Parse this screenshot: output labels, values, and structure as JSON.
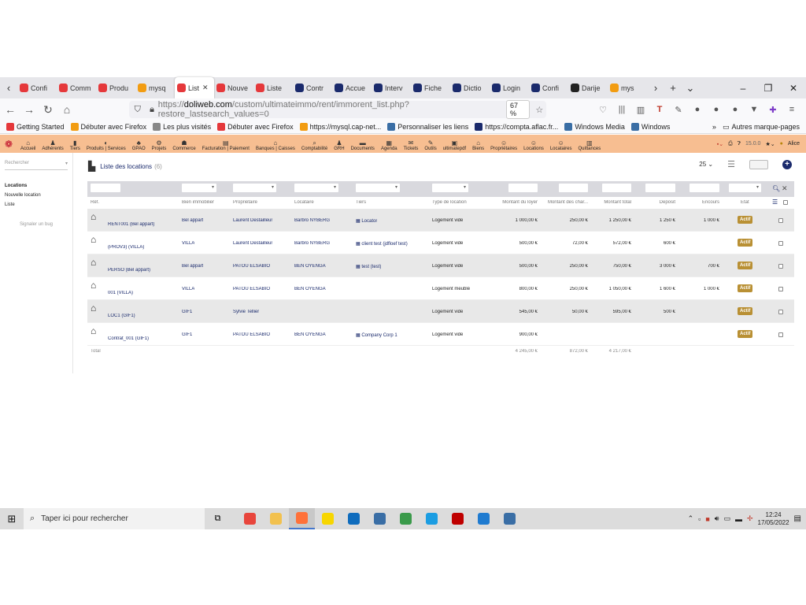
{
  "browser": {
    "tabs": [
      {
        "label": "Confi",
        "color": "#e5383b"
      },
      {
        "label": "Comm",
        "color": "#e5383b"
      },
      {
        "label": "Produ",
        "color": "#e5383b"
      },
      {
        "label": "mysq",
        "color": "#f29c11"
      },
      {
        "label": "List",
        "color": "#e5383b",
        "active": true
      },
      {
        "label": "Nouve",
        "color": "#e5383b"
      },
      {
        "label": "Liste",
        "color": "#e5383b"
      },
      {
        "label": "Contr",
        "color": "#1a2a6c"
      },
      {
        "label": "Accue",
        "color": "#1a2a6c"
      },
      {
        "label": "Interv",
        "color": "#1a2a6c"
      },
      {
        "label": "Fiche",
        "color": "#1a2a6c"
      },
      {
        "label": "Dictio",
        "color": "#1a2a6c"
      },
      {
        "label": "Login",
        "color": "#1a2a6c"
      },
      {
        "label": "Confi",
        "color": "#1a2a6c"
      },
      {
        "label": "Darije",
        "color": "#222222"
      },
      {
        "label": "mys",
        "color": "#f29c11"
      }
    ],
    "url_scheme": "https://",
    "url_domain": "doliweb.com",
    "url_path": "/custom/ultimateimmo/rent/immorent_list.php?restore_lastsearch_values=0",
    "zoom": "67 %",
    "bookmarks": [
      {
        "label": "Getting Started",
        "color": "#e5383b"
      },
      {
        "label": "Débuter avec Firefox",
        "color": "#f29c11"
      },
      {
        "label": "Les plus visités",
        "color": "#888888"
      },
      {
        "label": "Débuter avec Firefox",
        "color": "#e5383b"
      },
      {
        "label": "https://mysql.cap-net...",
        "color": "#f29c11"
      },
      {
        "label": "Personnaliser les liens",
        "color": "#3a6ea5"
      },
      {
        "label": "https://compta.aflac.fr...",
        "color": "#1a2a6c"
      },
      {
        "label": "Windows Media",
        "color": "#3a6ea5"
      },
      {
        "label": "Windows",
        "color": "#3a6ea5"
      }
    ],
    "other_bookmarks": "Autres marque-pages"
  },
  "topmenu": {
    "items": [
      "Accueil",
      "Adhérents",
      "Tiers",
      "Produits | Services",
      "GPAO",
      "Projets",
      "Commerce",
      "Facturation | Paiement",
      "Banques | Caisses",
      "Comptabilité",
      "GRH",
      "Documents",
      "Agenda",
      "Tickets",
      "Outils",
      "ultimatepdf",
      "Biens",
      "Propriétaires",
      "Locations",
      "Locataires",
      "Quittances"
    ],
    "version": "15.0.0",
    "user": "Alice"
  },
  "sidebar": {
    "search_placeholder": "Rechercher",
    "menu_head": "Locations",
    "menu_items": [
      "Nouvelle location",
      "Liste"
    ],
    "bug_link": "Signaler un bug"
  },
  "page": {
    "title": "Liste des locations",
    "count": "(6)",
    "page_size": "25"
  },
  "table": {
    "headers": {
      "ref": "Réf.",
      "bien": "Bien immobilier",
      "proprietaire": "Propriétaire",
      "locataire": "Locataire",
      "tiers": "Tiers",
      "type": "Type de location",
      "loyer": "Montant du loyer",
      "charges": "Montant des char...",
      "total": "Montant total",
      "deposit": "Deposit",
      "encours": "Encours",
      "etat": "État"
    },
    "rows": [
      {
        "ref": "RENT001 (Bel appart)",
        "bien": "Bel appart",
        "proprietaire": "Laurent Destailleur",
        "locataire": "Barbro NYBERG",
        "tiers": "Locator",
        "type": "Logement vide",
        "loyer": "1 000,00 €",
        "charges": "250,00 €",
        "total": "1 250,00 €",
        "deposit": "1 250 €",
        "encours": "1 000 €",
        "etat": "Actif"
      },
      {
        "ref": "(PROV3) (VILLA)",
        "bien": "VILLA",
        "proprietaire": "Laurent Destailleur",
        "locataire": "Barbro NYBERG",
        "tiers": "client test (jdfloef test)",
        "type": "Logement vide",
        "loyer": "500,00 €",
        "charges": "72,00 €",
        "total": "572,00 €",
        "deposit": "600 €",
        "encours": "",
        "etat": "Actif"
      },
      {
        "ref": "PERSO (Bel appart)",
        "bien": "Bel appart",
        "proprietaire": "PATOU ELSABIO",
        "locataire": "BEN OYENGA",
        "tiers": "test (test)",
        "type": "Logement vide",
        "loyer": "500,00 €",
        "charges": "250,00 €",
        "total": "750,00 €",
        "deposit": "3 000 €",
        "encours": "700 €",
        "etat": "Actif"
      },
      {
        "ref": "001 (VILLA)",
        "bien": "VILLA",
        "proprietaire": "PATOU ELSABIO",
        "locataire": "BEN OYENGA",
        "tiers": "",
        "type": "Logement meublé",
        "loyer": "800,00 €",
        "charges": "250,00 €",
        "total": "1 050,00 €",
        "deposit": "1 600 €",
        "encours": "1 000 €",
        "etat": "Actif"
      },
      {
        "ref": "LOC1 (GIF1)",
        "bien": "GIF1",
        "proprietaire": "Sylvie Tellier",
        "locataire": "",
        "tiers": "",
        "type": "Logement vide",
        "loyer": "545,00 €",
        "charges": "50,00 €",
        "total": "595,00 €",
        "deposit": "500 €",
        "encours": "",
        "etat": "Actif"
      },
      {
        "ref": "Contrat_001 (GIF1)",
        "bien": "GIF1",
        "proprietaire": "PATOU ELSABIO",
        "locataire": "BEN OYENGA",
        "tiers": "Company Corp 1",
        "type": "Logement vide",
        "loyer": "900,00 €",
        "charges": "",
        "total": "",
        "deposit": "",
        "encours": "",
        "etat": "Actif"
      }
    ],
    "total_label": "Total",
    "totals": {
      "loyer": "4 245,00 €",
      "charges": "872,00 €",
      "total": "4 217,00 €"
    }
  },
  "taskbar": {
    "search_placeholder": "Taper ici pour rechercher",
    "time": "12:24",
    "date": "17/05/2022",
    "apps": [
      {
        "name": "chrome",
        "color": "#e8453c"
      },
      {
        "name": "explorer",
        "color": "#f2c14e"
      },
      {
        "name": "firefox",
        "color": "#ff7139",
        "active": true
      },
      {
        "name": "sticky",
        "color": "#f7d600"
      },
      {
        "name": "outlook",
        "color": "#0f6cbd"
      },
      {
        "name": "network",
        "color": "#3a6ea5"
      },
      {
        "name": "excel-like",
        "color": "#3a9a4a"
      },
      {
        "name": "edge",
        "color": "#1b9de2"
      },
      {
        "name": "filezilla",
        "color": "#bf0000"
      },
      {
        "name": "vscode",
        "color": "#1f7bd0"
      },
      {
        "name": "network2",
        "color": "#3a6ea5"
      }
    ]
  },
  "colors": {
    "menu_bg": "#f7be91",
    "badge": "#b99034",
    "link": "#1a2a6c"
  }
}
